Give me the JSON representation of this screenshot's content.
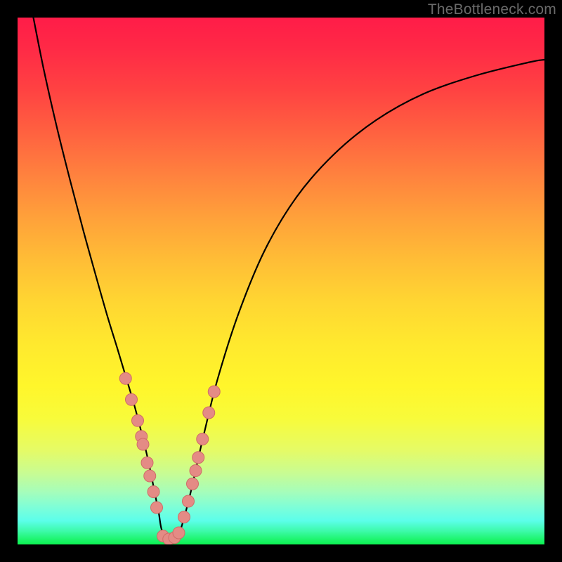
{
  "watermark": "TheBottleneck.com",
  "accent": {
    "curve_stroke": "#000000",
    "dot_fill": "#e48b85",
    "dot_stroke": "#cf6d67"
  },
  "chart_data": {
    "type": "line",
    "title": "",
    "xlabel": "",
    "ylabel": "",
    "xlim": [
      0,
      100
    ],
    "ylim": [
      0,
      100
    ],
    "grid": false,
    "legend": false,
    "note": "Axes are percentage of plot area. y increases downward visually; values below are top-anchored (0 = top, 100 = bottom).",
    "series": [
      {
        "name": "left-branch",
        "x": [
          3.0,
          5.0,
          7.5,
          10.0,
          12.5,
          15.0,
          17.0,
          19.0,
          20.5,
          22.0,
          23.2,
          24.2,
          25.0,
          25.6,
          26.2,
          26.8,
          27.3
        ],
        "y": [
          0.0,
          10.0,
          21.0,
          31.0,
          40.5,
          49.5,
          56.5,
          63.0,
          68.0,
          73.0,
          77.5,
          81.5,
          85.0,
          88.0,
          91.0,
          94.0,
          97.0
        ]
      },
      {
        "name": "valley-floor",
        "x": [
          27.3,
          28.2,
          29.2,
          30.2,
          31.0
        ],
        "y": [
          97.0,
          98.8,
          99.0,
          98.8,
          97.0
        ]
      },
      {
        "name": "right-branch",
        "x": [
          31.0,
          32.0,
          33.0,
          34.0,
          35.5,
          38.0,
          42.0,
          47.0,
          53.0,
          60.0,
          68.0,
          77.0,
          87.0,
          97.0,
          100.0
        ],
        "y": [
          97.0,
          93.5,
          89.5,
          85.0,
          78.5,
          68.5,
          56.0,
          44.0,
          34.0,
          26.0,
          19.5,
          14.5,
          11.0,
          8.5,
          8.0
        ]
      }
    ],
    "dots_left": {
      "name": "left-cluster",
      "x": [
        20.5,
        21.6,
        22.8,
        23.5,
        23.8,
        24.6,
        25.1,
        25.8,
        26.4,
        27.6,
        28.7,
        29.8,
        30.6
      ],
      "y": [
        68.5,
        72.5,
        76.5,
        79.5,
        81.0,
        84.5,
        87.0,
        90.0,
        93.0,
        98.4,
        99.0,
        98.7,
        97.8
      ]
    },
    "dots_right": {
      "name": "right-cluster",
      "x": [
        31.6,
        32.4,
        33.2,
        33.8,
        34.3,
        35.1,
        36.3,
        37.3
      ],
      "y": [
        94.8,
        91.8,
        88.5,
        86.0,
        83.5,
        80.0,
        75.0,
        71.0
      ]
    }
  }
}
